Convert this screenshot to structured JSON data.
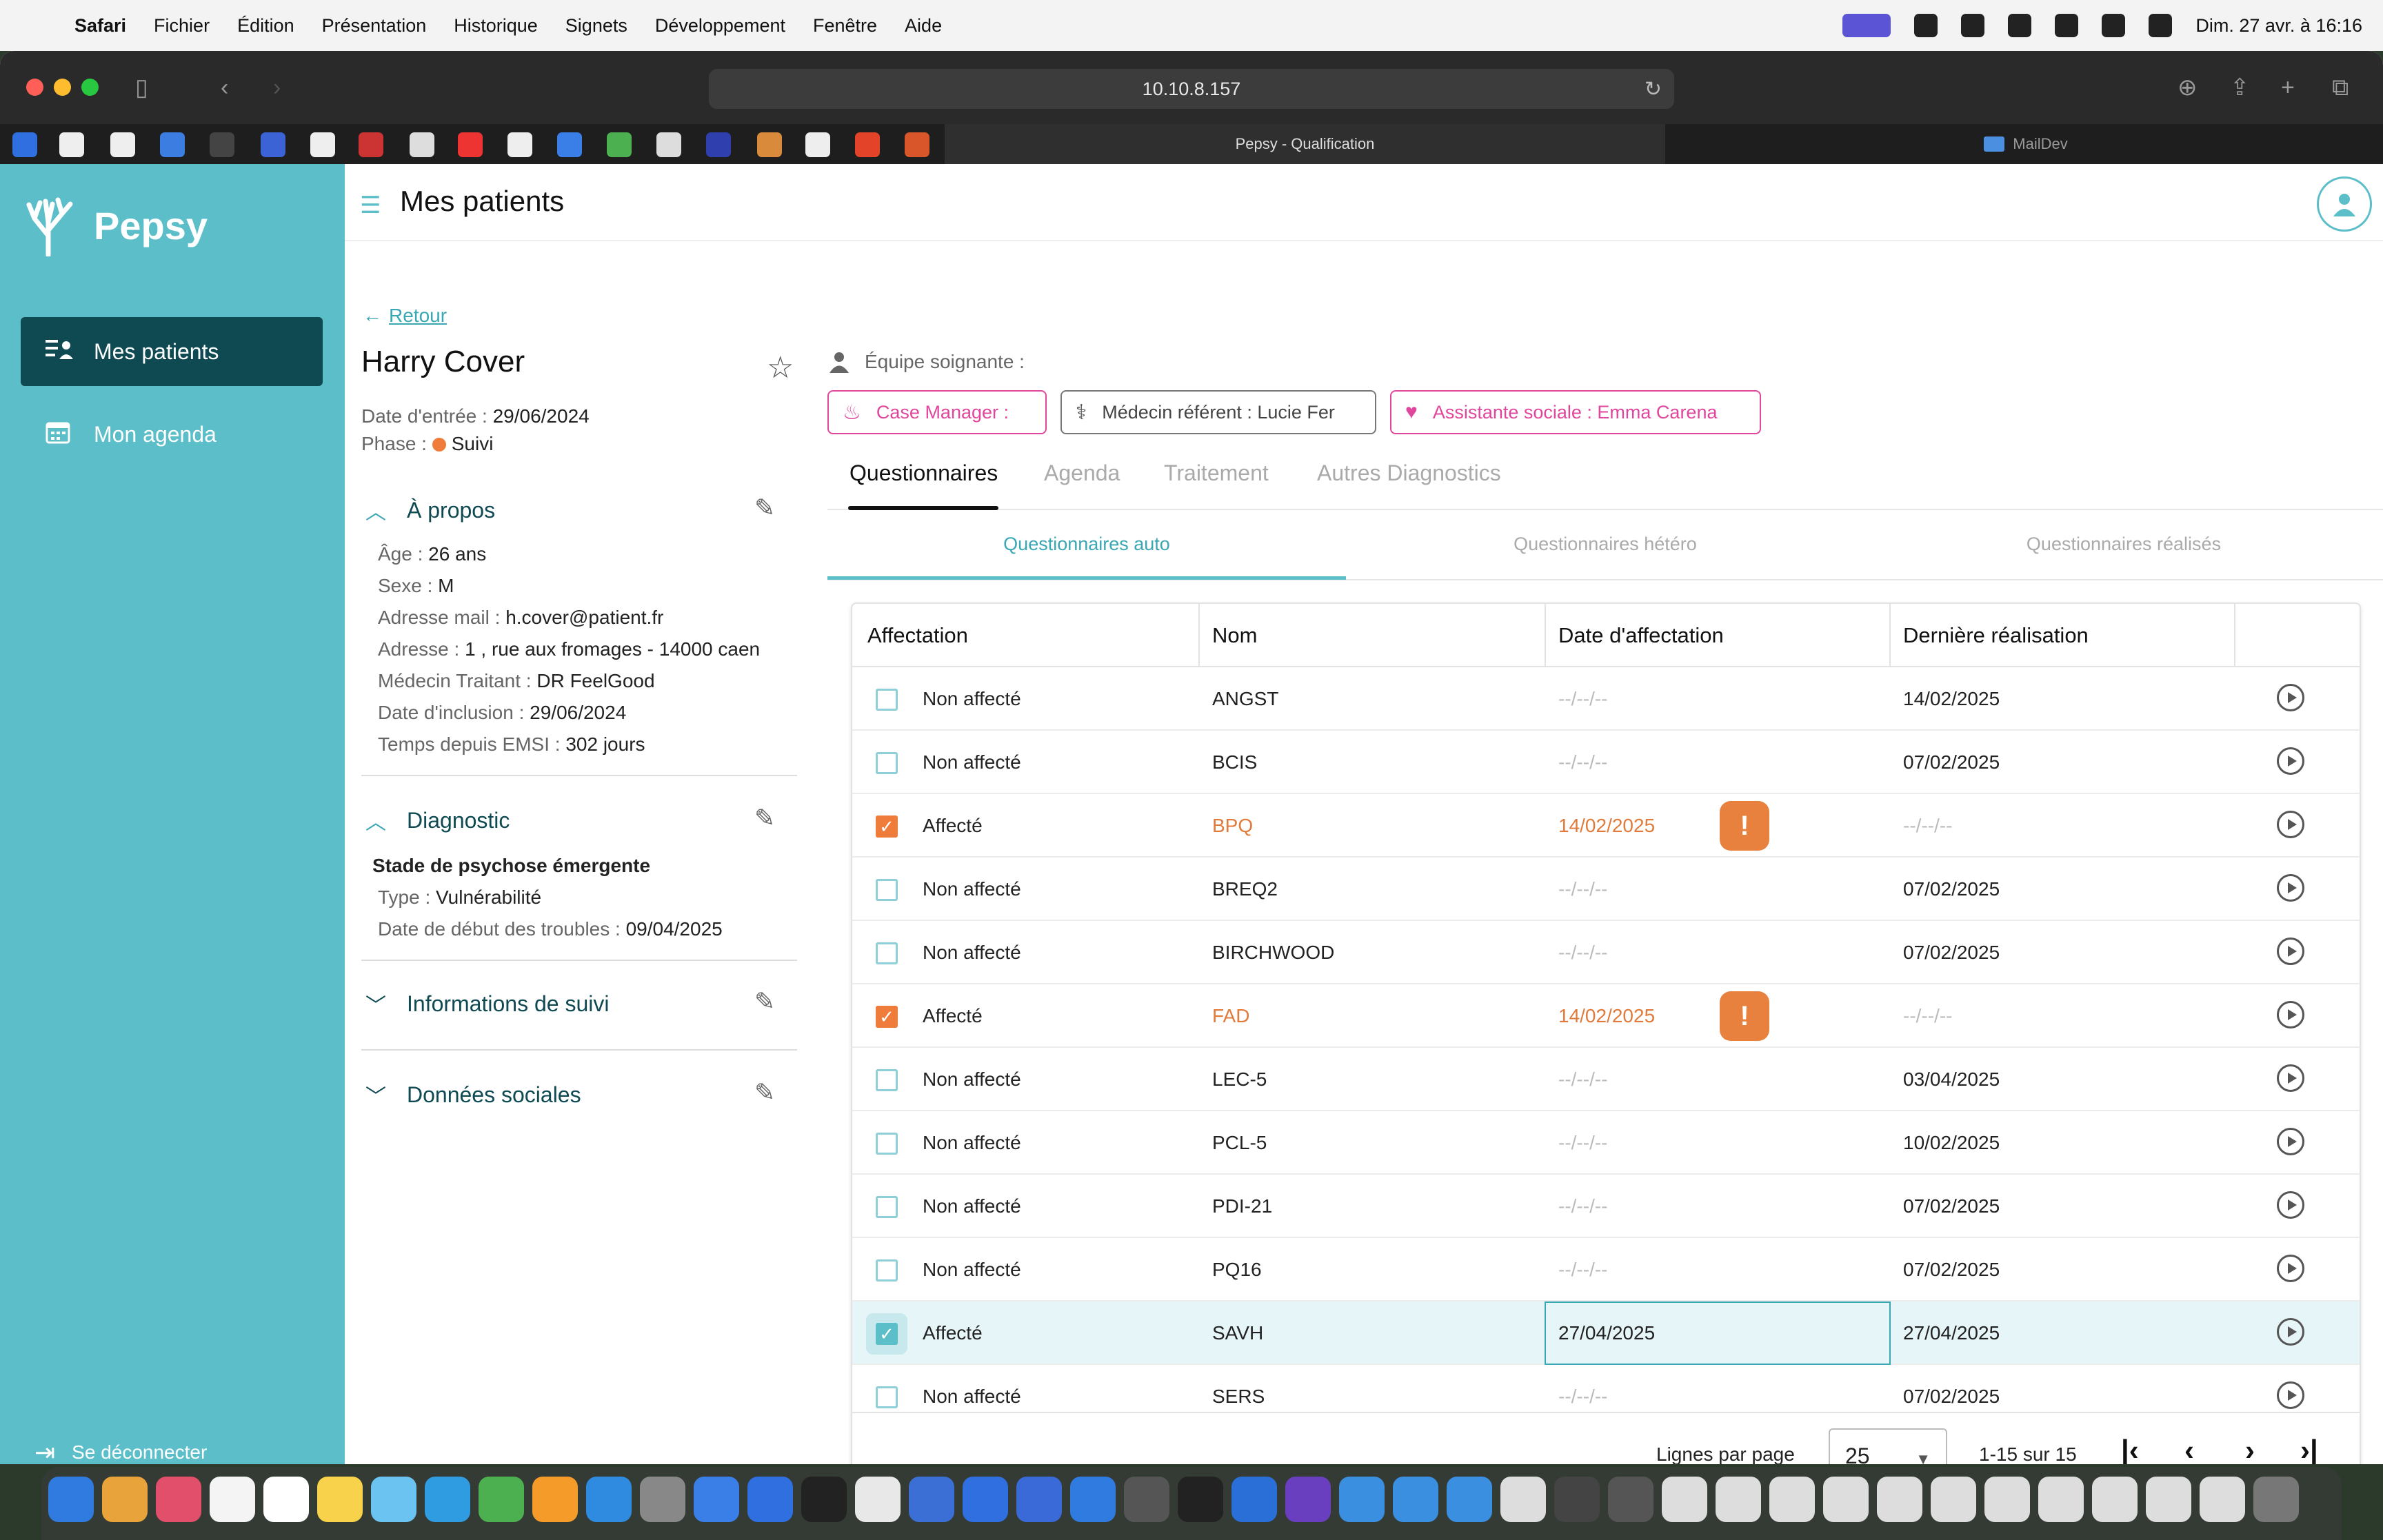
{
  "menubar": {
    "app": "Safari",
    "items": [
      "Fichier",
      "Édition",
      "Présentation",
      "Historique",
      "Signets",
      "Développement",
      "Fenêtre",
      "Aide"
    ],
    "clock": "Dim. 27 avr. à 16:16"
  },
  "browser": {
    "url": "10.10.8.157",
    "tabs": [
      {
        "title": "Pepsy - Qualification",
        "active": true
      },
      {
        "title": "MailDev",
        "active": false
      }
    ]
  },
  "sidebar": {
    "brand": "Pepsy",
    "items": [
      {
        "label": "Mes patients",
        "active": true,
        "icon": "patients-icon"
      },
      {
        "label": "Mon agenda",
        "active": false,
        "icon": "calendar-icon"
      }
    ],
    "logout": "Se déconnecter"
  },
  "header": {
    "title": "Mes patients"
  },
  "patient": {
    "back": "Retour",
    "name": "Harry Cover",
    "entry_label": "Date d'entrée :",
    "entry_value": "29/06/2024",
    "phase_label": "Phase :",
    "phase_value": "Suivi",
    "about": {
      "title": "À propos",
      "fields": [
        {
          "label": "Âge :",
          "value": "26 ans"
        },
        {
          "label": "Sexe :",
          "value": "M"
        },
        {
          "label": "Adresse mail :",
          "value": "h.cover@patient.fr"
        },
        {
          "label": "Adresse :",
          "value": "1 , rue aux fromages - 14000 caen"
        },
        {
          "label": "Médecin Traitant :",
          "value": "DR FeelGood"
        },
        {
          "label": "Date d'inclusion :",
          "value": "29/06/2024"
        },
        {
          "label": "Temps depuis EMSI :",
          "value": "302 jours"
        }
      ]
    },
    "diagnostic": {
      "title": "Diagnostic",
      "stage": "Stade de psychose émergente",
      "fields": [
        {
          "label": "Type :",
          "value": "Vulnérabilité"
        },
        {
          "label": "Date de début des troubles :",
          "value": "09/04/2025"
        }
      ]
    },
    "followup": {
      "title": "Informations de suivi"
    },
    "social": {
      "title": "Données sociales"
    }
  },
  "team": {
    "label": "Équipe soignante :",
    "chips": [
      {
        "label": "Case Manager :",
        "style": "pink"
      },
      {
        "label": "Médecin référent : Lucie Fer",
        "style": "grey"
      },
      {
        "label": "Assistante sociale : Emma Carena",
        "style": "pink"
      }
    ]
  },
  "tabs": [
    "Questionnaires",
    "Agenda",
    "Traitement",
    "Autres Diagnostics"
  ],
  "subtabs": [
    "Questionnaires auto",
    "Questionnaires hétéro",
    "Questionnaires réalisés"
  ],
  "table": {
    "columns": [
      "Affectation",
      "Nom",
      "Date d'affectation",
      "Dernière réalisation"
    ],
    "rows": [
      {
        "checked": false,
        "status": "Non affecté",
        "name": "ANGST",
        "date": "--/--/--",
        "last": "14/02/2025"
      },
      {
        "checked": false,
        "status": "Non affecté",
        "name": "BCIS",
        "date": "--/--/--",
        "last": "07/02/2025"
      },
      {
        "checked": true,
        "status": "Affecté",
        "name": "BPQ",
        "date": "14/02/2025",
        "last": "--/--/--",
        "badge": true
      },
      {
        "checked": false,
        "status": "Non affecté",
        "name": "BREQ2",
        "date": "--/--/--",
        "last": "07/02/2025"
      },
      {
        "checked": false,
        "status": "Non affecté",
        "name": "BIRCHWOOD",
        "date": "--/--/--",
        "last": "07/02/2025"
      },
      {
        "checked": true,
        "status": "Affecté",
        "name": "FAD",
        "date": "14/02/2025",
        "last": "--/--/--",
        "badge": true
      },
      {
        "checked": false,
        "status": "Non affecté",
        "name": "LEC-5",
        "date": "--/--/--",
        "last": "03/04/2025"
      },
      {
        "checked": false,
        "status": "Non affecté",
        "name": "PCL-5",
        "date": "--/--/--",
        "last": "10/02/2025"
      },
      {
        "checked": false,
        "status": "Non affecté",
        "name": "PDI-21",
        "date": "--/--/--",
        "last": "07/02/2025"
      },
      {
        "checked": false,
        "status": "Non affecté",
        "name": "PQ16",
        "date": "--/--/--",
        "last": "07/02/2025"
      },
      {
        "checked": true,
        "status": "Affecté",
        "name": "SAVH",
        "date": "27/04/2025",
        "last": "27/04/2025",
        "selected": true
      },
      {
        "checked": false,
        "status": "Non affecté",
        "name": "SERS",
        "date": "--/--/--",
        "last": "07/02/2025"
      }
    ],
    "footer": {
      "rows_per_page_label": "Lignes par page",
      "rows_per_page": "25",
      "range": "1-15 sur 15"
    }
  },
  "colors": {
    "accent": "#5bbec8",
    "dark": "#0f4a52",
    "orange": "#f07c3c",
    "pink": "#e0479c"
  }
}
